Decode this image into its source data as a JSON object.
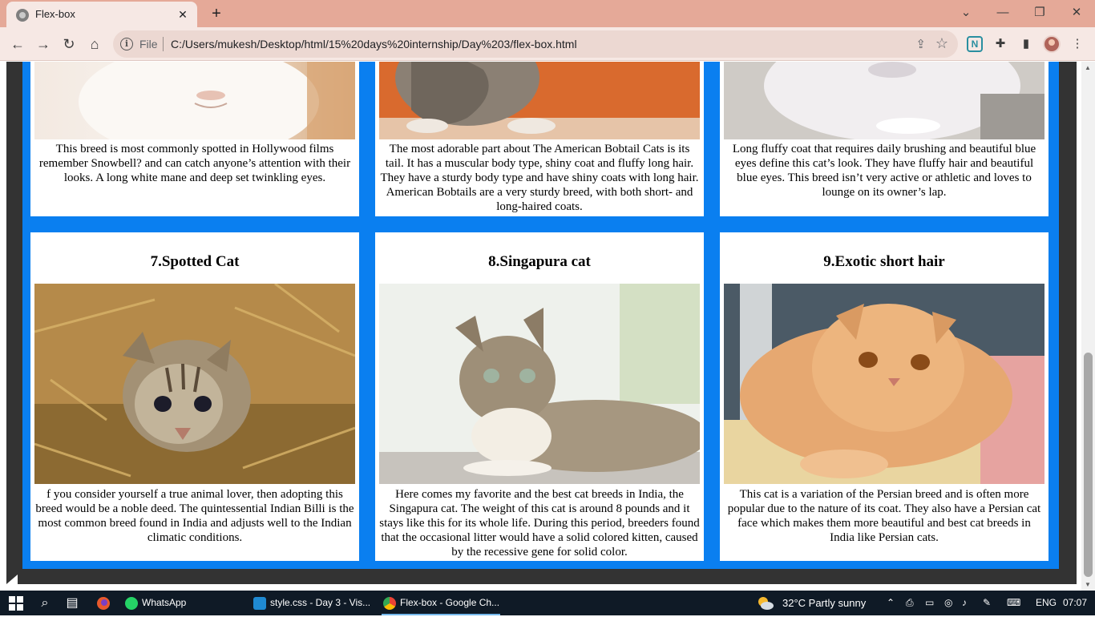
{
  "browser": {
    "tab_title": "Flex-box",
    "tab_close": "✕",
    "new_tab": "+",
    "file_label": "File",
    "url": "C:/Users/mukesh/Desktop/html/15%20days%20internship/Day%203/flex-box.html",
    "window_controls": {
      "dropdown": "⌄",
      "minimize": "—",
      "restore": "❐",
      "close": "✕"
    },
    "nav": {
      "back": "←",
      "forward": "→",
      "reload": "↻",
      "home": "⌂"
    },
    "ext_n": "N"
  },
  "cards": [
    {
      "text": "This breed is most commonly spotted in Hollywood films remember Snowbell? and can catch anyone’s attention with their looks. A long white mane and deep set twinkling eyes."
    },
    {
      "text": "The most adorable part about The American Bobtail Cats is its tail. It has a muscular body type, shiny coat and fluffy long hair. They have a sturdy body type and have shiny coats with long hair. American Bobtails are a very sturdy breed, with both short- and long-haired coats."
    },
    {
      "text": "Long fluffy coat that requires daily brushing and beautiful blue eyes define this cat’s look. They have fluffy hair and beautiful blue eyes. This breed isn’t very active or athletic and loves to lounge on its owner’s lap."
    },
    {
      "title": "7.Spotted Cat",
      "text": "f you consider yourself a true animal lover, then adopting this breed would be a noble deed. The quintessential Indian Billi is the most common breed found in India and adjusts well to the Indian climatic conditions."
    },
    {
      "title": "8.Singapura cat",
      "text": "Here comes my favorite and the best cat breeds in India, the Singapura cat. The weight of this cat is around 8 pounds and it stays like this for its whole life. During this period, breeders found that the occasional litter would have a solid colored kitten, caused by the recessive gene for solid color."
    },
    {
      "title": "9.Exotic short hair",
      "text": "This cat is a variation of the Persian breed and is often more popular due to the nature of its coat. They also have a Persian cat face which makes them more beautiful and best cat breeds in India like Persian cats."
    }
  ],
  "taskbar": {
    "apps": [
      {
        "label": "WhatsApp"
      },
      {
        "label": "style.css - Day 3 - Vis..."
      },
      {
        "label": "Flex-box - Google Ch..."
      }
    ],
    "weather": "32°C  Partly sunny",
    "language": "ENG",
    "time": "07:07"
  },
  "colors": {
    "page_blue": "#0a7ff0",
    "page_dark": "#333333",
    "tab_strip": "#e5a998",
    "toolbar": "#f6e8e4",
    "taskbar": "#0f1a26"
  }
}
